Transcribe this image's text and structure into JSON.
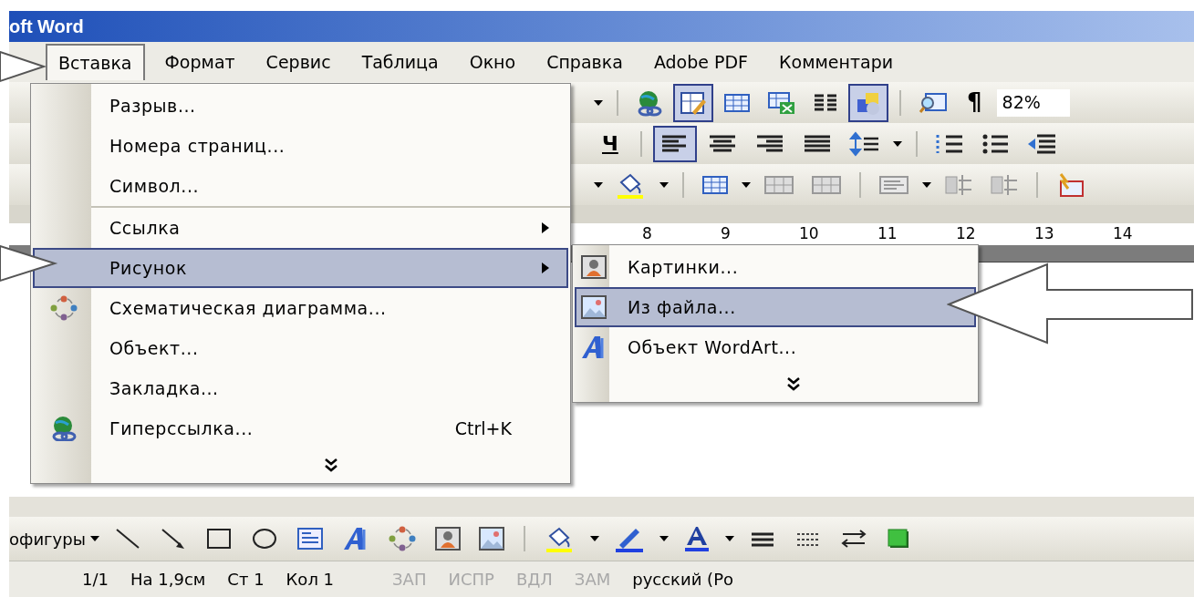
{
  "window": {
    "title": "oft Word"
  },
  "menu_bar": [
    {
      "label": "Вставка",
      "selected": true
    },
    {
      "label": "Формат",
      "selected": false
    },
    {
      "label": "Сервис",
      "selected": false
    },
    {
      "label": "Таблица",
      "selected": false
    },
    {
      "label": "Окно",
      "selected": false
    },
    {
      "label": "Справка",
      "selected": false
    },
    {
      "label": "Adobe PDF",
      "selected": false
    },
    {
      "label": "Комментари",
      "selected": false
    }
  ],
  "toolbar": {
    "underline_button": "Ч",
    "pilcrow_button": "¶",
    "zoom": "82%"
  },
  "ruler": [
    "8",
    "9",
    "10",
    "11",
    "12",
    "13",
    "14"
  ],
  "insert_menu": [
    {
      "kind": "item",
      "label": "Разрыв...",
      "submenu": false,
      "selected": false
    },
    {
      "kind": "item",
      "label": "Номера страниц...",
      "submenu": false,
      "selected": false
    },
    {
      "kind": "item",
      "label": "Символ...",
      "submenu": false,
      "selected": false
    },
    {
      "kind": "separator"
    },
    {
      "kind": "item",
      "label": "Ссылка",
      "submenu": true,
      "selected": false
    },
    {
      "kind": "item",
      "label": "Рисунок",
      "submenu": true,
      "selected": true
    },
    {
      "kind": "item",
      "label": "Схематическая диаграмма...",
      "submenu": false,
      "selected": false
    },
    {
      "kind": "item",
      "label": "Объект...",
      "submenu": false,
      "selected": false
    },
    {
      "kind": "item",
      "label": "Закладка...",
      "submenu": false,
      "selected": false
    },
    {
      "kind": "item",
      "label": "Гиперссылка...",
      "shortcut": "Ctrl+K",
      "submenu": false,
      "selected": false
    },
    {
      "kind": "expand"
    }
  ],
  "picture_submenu": [
    {
      "kind": "item",
      "label": "Картинки...",
      "selected": false
    },
    {
      "kind": "item",
      "label": "Из файла...",
      "selected": true
    },
    {
      "kind": "item",
      "label": "Объект WordArt...",
      "selected": false
    },
    {
      "kind": "expand"
    }
  ],
  "drawing_toolbar": {
    "label": "офигуры"
  },
  "status_bar": [
    {
      "text": "1/1",
      "disabled": false
    },
    {
      "text": "На 1,9см",
      "disabled": false
    },
    {
      "text": "Ст 1",
      "disabled": false
    },
    {
      "text": "Кол 1",
      "disabled": false
    },
    {
      "text": "ЗАП",
      "disabled": true
    },
    {
      "text": "ИСПР",
      "disabled": true
    },
    {
      "text": "ВДЛ",
      "disabled": true
    },
    {
      "text": "ЗАМ",
      "disabled": true
    },
    {
      "text": "русский (Ро",
      "disabled": false
    }
  ]
}
